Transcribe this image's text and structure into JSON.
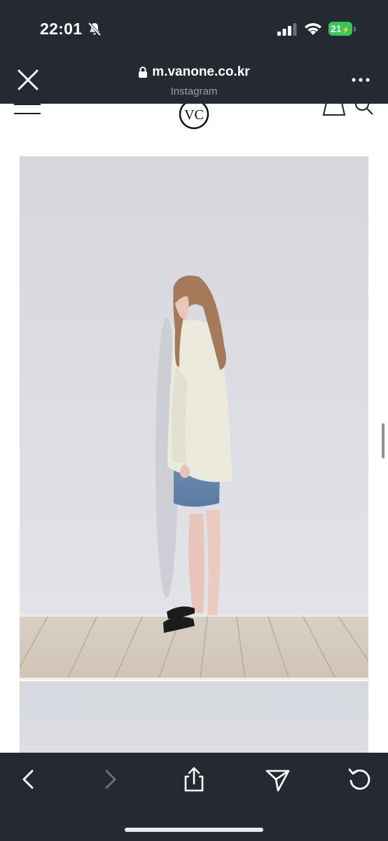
{
  "status_bar": {
    "time": "22:01",
    "battery": "21",
    "battery_color": "#34c759"
  },
  "browser": {
    "url": "m.vanone.co.kr",
    "subtitle": "Instagram"
  },
  "site": {
    "logo_alt": "VC"
  },
  "icons": [
    "close-icon",
    "lock-icon",
    "more-icon",
    "menu-icon",
    "bag-icon",
    "search-icon",
    "back-icon",
    "forward-icon",
    "share-icon",
    "send-icon",
    "refresh-icon"
  ],
  "colors": {
    "chrome": "#252a32",
    "subtitle": "#9aa0a8"
  }
}
